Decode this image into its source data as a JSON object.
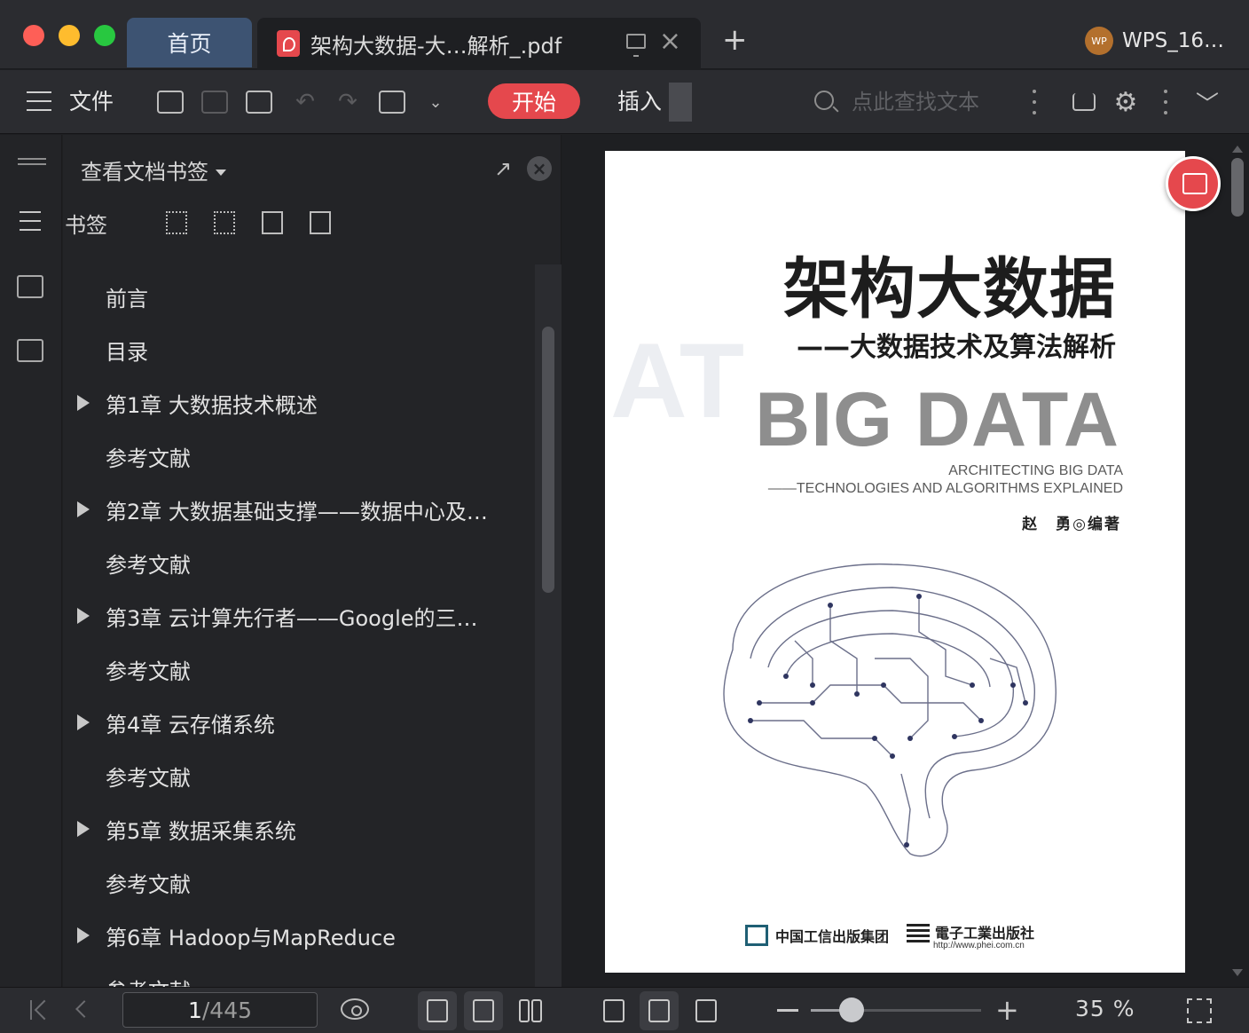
{
  "window": {
    "tabs": [
      {
        "label": "首页",
        "active": false
      },
      {
        "label": "架构大数据-大…解析_.pdf",
        "active": true
      }
    ],
    "user_name": "WPS_16…",
    "avatar_text": "WP"
  },
  "toolbar": {
    "menu_icon": "hamburger-icon",
    "file_label": "文件",
    "start_label": "开始",
    "insert_label": "插入",
    "search_placeholder": "点此查找文本",
    "accent_color": "#e5484d"
  },
  "bookmark_panel": {
    "title": "查看文档书签",
    "section_label": "书签",
    "items": [
      {
        "label": "前言",
        "expandable": false
      },
      {
        "label": "目录",
        "expandable": false
      },
      {
        "label": "第1章 大数据技术概述",
        "expandable": true
      },
      {
        "label": "参考文献",
        "expandable": false
      },
      {
        "label": "第2章 大数据基础支撑——数据中心及…",
        "expandable": true
      },
      {
        "label": "参考文献",
        "expandable": false
      },
      {
        "label": "第3章 云计算先行者——Google的三…",
        "expandable": true
      },
      {
        "label": "参考文献",
        "expandable": false
      },
      {
        "label": "第4章 云存储系统",
        "expandable": true
      },
      {
        "label": "参考文献",
        "expandable": false
      },
      {
        "label": "第5章 数据采集系统",
        "expandable": true
      },
      {
        "label": "参考文献",
        "expandable": false
      },
      {
        "label": "第6章 Hadoop与MapReduce",
        "expandable": true
      },
      {
        "label": "参考文献",
        "expandable": false
      }
    ]
  },
  "cover": {
    "title": "架构大数据",
    "subtitle": "——大数据技术及算法解析",
    "big_text": "BIG DATA",
    "english_line1": "ARCHITECTING BIG DATA",
    "english_line2": "——TECHNOLOGIES AND ALGORITHMS EXPLAINED",
    "author": "赵　勇◎编著",
    "publisher1": "中国工信出版集团",
    "publisher2": "電子工業出版社",
    "publisher_url": "http://www.phei.com.cn"
  },
  "status": {
    "current_page": "1",
    "total_pages": "/445",
    "zoom": "35 %",
    "zoom_fraction": 0.24
  }
}
